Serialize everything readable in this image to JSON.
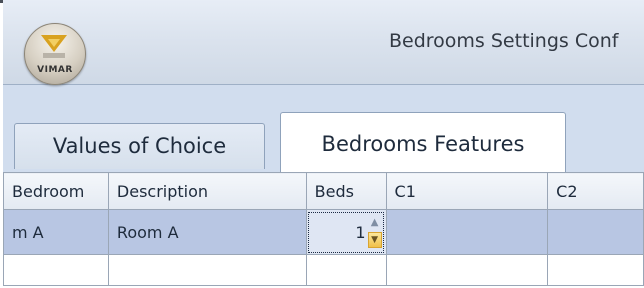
{
  "window": {
    "title": "Bedrooms Settings Conf",
    "logo_label": "VIMAR"
  },
  "tabs": [
    {
      "label": "Values of Choice",
      "active": false
    },
    {
      "label": "Bedrooms Features",
      "active": true
    }
  ],
  "grid": {
    "columns": [
      "Bedroom",
      "Description",
      "Beds",
      "C1",
      "C2"
    ],
    "rows": [
      {
        "bedroom": "m A",
        "description": "Room A",
        "beds": "1",
        "c1": "",
        "c2": "",
        "selected": true
      }
    ]
  },
  "spinner": {
    "up_icon": "▲",
    "down_icon": "▼"
  },
  "colors": {
    "window_bg": "#d1ddee",
    "selected_row": "#b8c6e3",
    "spinner_accent": "#f0c04a"
  }
}
